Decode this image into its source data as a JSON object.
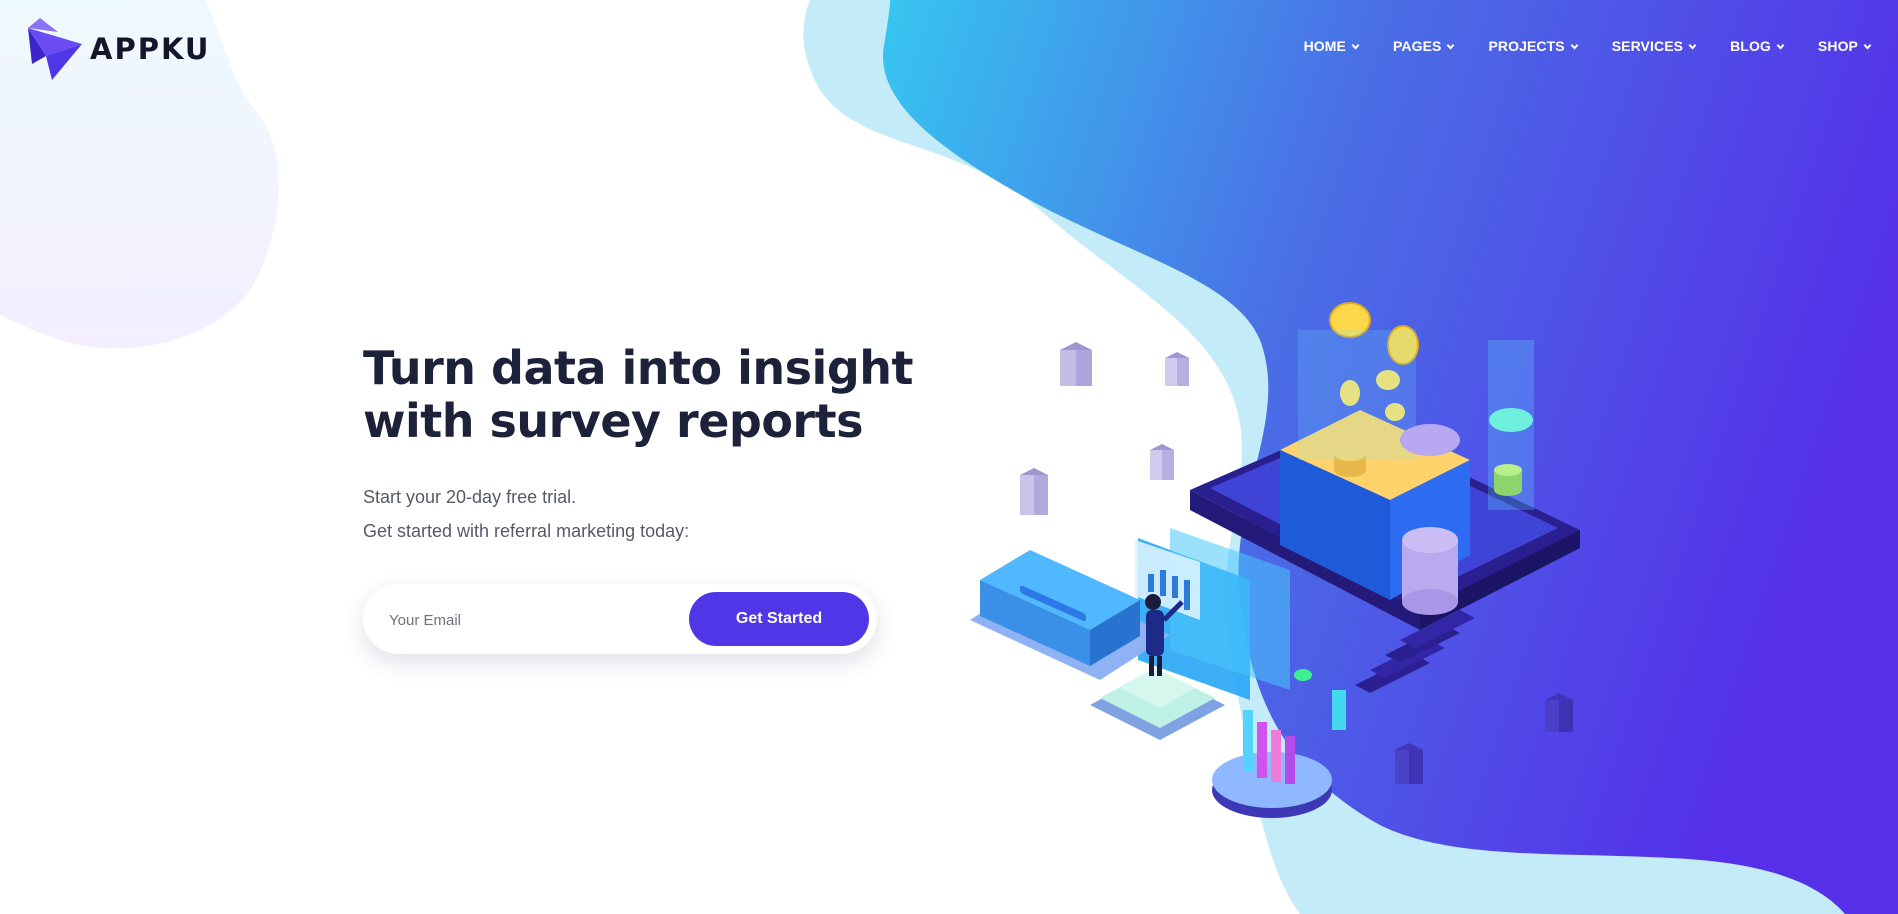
{
  "brand": {
    "name": "APPKU",
    "primary_color": "#4f36e6",
    "gradient_start": "#36c6f0",
    "gradient_end": "#5530e8",
    "text_dark": "#1c2239"
  },
  "nav": {
    "items": [
      {
        "label": "HOME",
        "icon": "chevron-down-icon"
      },
      {
        "label": "PAGES",
        "icon": "chevron-down-icon"
      },
      {
        "label": "PROJECTS",
        "icon": "chevron-down-icon"
      },
      {
        "label": "SERVICES",
        "icon": "chevron-down-icon"
      },
      {
        "label": "BLOG",
        "icon": "chevron-down-icon"
      },
      {
        "label": "SHOP",
        "icon": "chevron-down-icon"
      }
    ]
  },
  "hero": {
    "title_lines": [
      "Turn data into insight",
      "with survey reports"
    ],
    "subtitle_lines": [
      "Start your 20-day free trial.",
      "Get started with referral marketing today:"
    ],
    "email_placeholder": "Your Email",
    "cta_label": "Get Started"
  },
  "illustration": {
    "icon": "isometric-data-analytics-illustration"
  }
}
